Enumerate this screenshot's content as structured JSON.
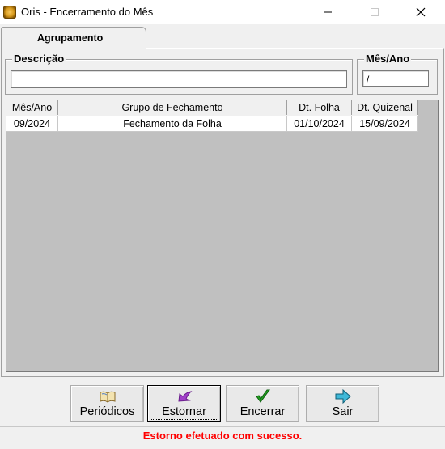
{
  "window": {
    "title": "Oris - Encerramento do Mês",
    "min": "—",
    "max": "☐",
    "close": "✕"
  },
  "tabs": [
    {
      "label": "Agrupamento"
    }
  ],
  "descricao": {
    "label": "Descrição",
    "value": ""
  },
  "mes_ano": {
    "label": "Mês/Ano",
    "value": " /"
  },
  "grid": {
    "columns": [
      "Mês/Ano",
      "Grupo de Fechamento",
      "Dt. Folha",
      "Dt. Quizenal"
    ],
    "rows": [
      [
        "09/2024",
        "Fechamento da Folha",
        "01/10/2024",
        "15/09/2024"
      ]
    ]
  },
  "buttons": {
    "periodicos": "Periódicos",
    "estornar": "Estornar",
    "encerrar": "Encerrar",
    "sair": "Sair"
  },
  "status": "Estorno efetuado com sucesso.",
  "colors": {
    "status": "#ff0000",
    "grid_bg": "#c0c0c0"
  }
}
